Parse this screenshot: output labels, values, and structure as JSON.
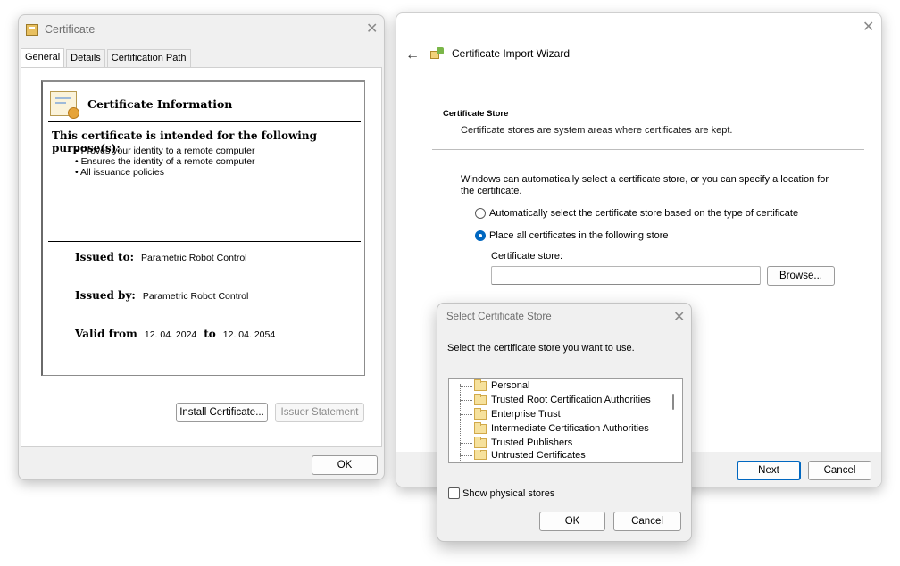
{
  "certificate_window": {
    "title": "Certificate",
    "tabs": [
      "General",
      "Details",
      "Certification Path"
    ],
    "info_heading": "Certificate Information",
    "purpose_title": "This certificate is intended for the following purpose(s):",
    "purposes": [
      "Proves your identity to a remote computer",
      "Ensures the identity of a remote computer",
      "All issuance policies"
    ],
    "issued_to_label": "Issued to:",
    "issued_to": "Parametric Robot Control",
    "issued_by_label": "Issued by:",
    "issued_by": "Parametric Robot Control",
    "valid_from_label": "Valid from",
    "valid_from": "12. 04. 2024",
    "to_label": "to",
    "valid_to": "12. 04. 2054",
    "install_button": "Install Certificate...",
    "issuer_button": "Issuer Statement",
    "ok_button": "OK"
  },
  "wizard": {
    "title": "Certificate Import Wizard",
    "section_heading": "Certificate Store",
    "section_sub": "Certificate stores are system areas where certificates are kept.",
    "description": "Windows can automatically select a certificate store, or you can specify a location for the certificate.",
    "radio_auto": "Automatically select the certificate store based on the type of certificate",
    "radio_place": "Place all certificates in the following store",
    "store_label": "Certificate store:",
    "store_value": "",
    "browse_button": "Browse...",
    "next_button": "Next",
    "cancel_button": "Cancel",
    "selected_option": "place"
  },
  "select_store_dialog": {
    "title": "Select Certificate Store",
    "prompt": "Select the certificate store you want to use.",
    "stores": [
      "Personal",
      "Trusted Root Certification Authorities",
      "Enterprise Trust",
      "Intermediate Certification Authorities",
      "Trusted Publishers",
      "Untrusted Certificates"
    ],
    "show_physical_label": "Show physical stores",
    "show_physical_checked": false,
    "ok_button": "OK",
    "cancel_button": "Cancel"
  },
  "icons": {
    "close": "close-icon",
    "back": "back-arrow-icon",
    "certificate": "certificate-icon",
    "folder": "folder-icon"
  },
  "colors": {
    "accent": "#0067c0",
    "window_bg": "#f0f0f0"
  }
}
